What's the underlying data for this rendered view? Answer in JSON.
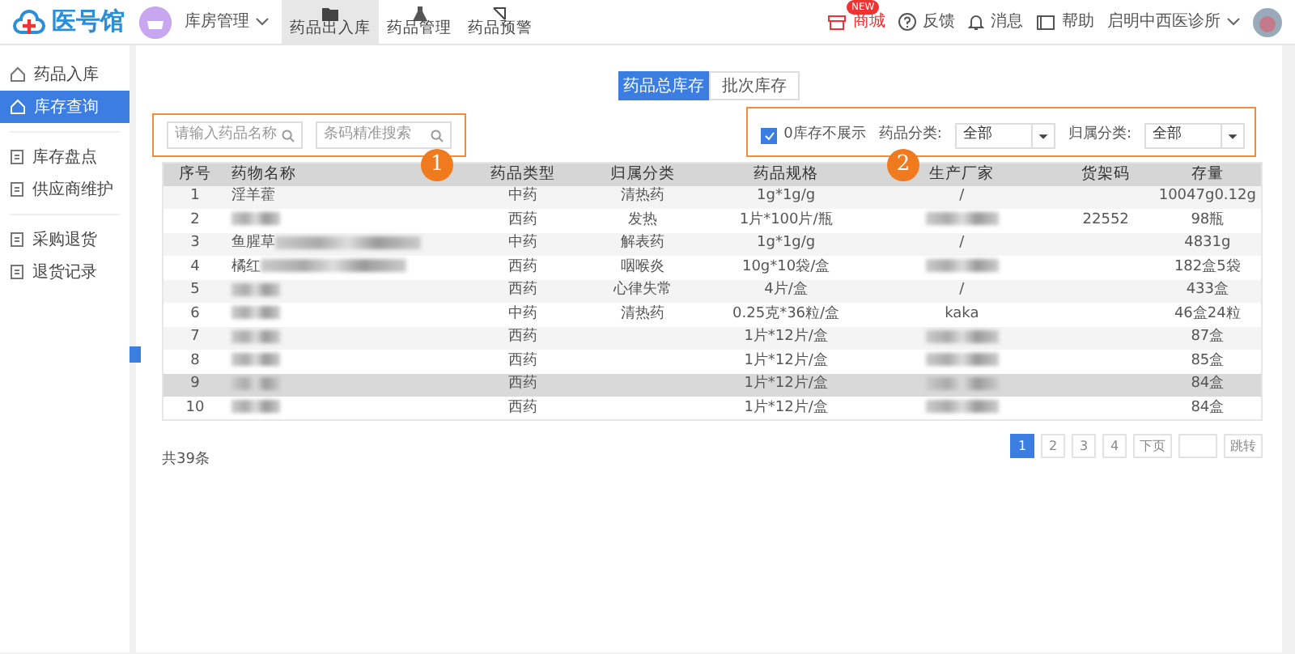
{
  "app": {
    "logo": "医号馆",
    "module": "库房管理",
    "tabs": [
      {
        "label": "药品出入库",
        "kind": "box",
        "selected": true
      },
      {
        "label": "药品管理",
        "kind": "flask",
        "selected": false
      },
      {
        "label": "药品预警",
        "kind": "alert",
        "selected": false
      }
    ],
    "header_links": [
      {
        "kind": "shop",
        "label": "商城",
        "badge": "NEW"
      },
      {
        "kind": "help",
        "label": "反馈"
      },
      {
        "kind": "bell",
        "label": "消息"
      },
      {
        "kind": "book",
        "label": "帮助"
      }
    ],
    "clinic": "启明中西医诊所"
  },
  "sidebar": {
    "groups": [
      [
        {
          "label": "药品入库",
          "kind": "home",
          "selected": false
        },
        {
          "label": "库存查询",
          "kind": "home",
          "selected": true
        }
      ],
      [
        {
          "label": "库存盘点",
          "kind": "doc",
          "selected": false
        },
        {
          "label": "供应商维护",
          "kind": "doc",
          "selected": false
        }
      ],
      [
        {
          "label": "采购退货",
          "kind": "doc",
          "selected": false
        },
        {
          "label": "退货记录",
          "kind": "doc",
          "selected": false
        }
      ]
    ]
  },
  "view_tabs": [
    {
      "label": "药品总库存",
      "selected": true
    },
    {
      "label": "批次库存",
      "selected": false
    }
  ],
  "search": [
    {
      "placeholder": "请输入药品名称"
    },
    {
      "placeholder": "条码精准搜索"
    }
  ],
  "filters": {
    "hide_zero": {
      "label": "0库存不展示",
      "checked": true
    },
    "selects": [
      {
        "label": "药品分类:",
        "value": "全部"
      },
      {
        "label": "归属分类:",
        "value": "全部"
      }
    ]
  },
  "callouts": [
    "1",
    "2"
  ],
  "table": {
    "columns": [
      "序号",
      "药物名称",
      "药品类型",
      "归属分类",
      "药品规格",
      "生产厂家",
      "货架码",
      "存量"
    ],
    "rows": [
      {
        "no": "1",
        "name": "淫羊藿",
        "type": "中药",
        "category": "清热药",
        "spec": "1g*1g/g",
        "maker": "/",
        "stock": "10047g0.12g",
        "selected": false
      },
      {
        "no": "2",
        "name_blurred": true,
        "type": "西药",
        "category": "发热",
        "spec": "1片*100片/瓶",
        "maker_blurred": true,
        "shelf": "22552",
        "stock": "98瓶",
        "selected": false
      },
      {
        "no": "3",
        "name": "鱼腥草",
        "name_blurred": true,
        "type": "中药",
        "category": "解表药",
        "spec": "1g*1g/g",
        "maker": "/",
        "stock": "4831g",
        "selected": false
      },
      {
        "no": "4",
        "name": "橘红",
        "name_blurred": true,
        "type": "西药",
        "category": "咽喉炎",
        "spec": "10g*10袋/盒",
        "maker_blurred": true,
        "stock": "182盒5袋",
        "selected": false
      },
      {
        "no": "5",
        "name_blurred": true,
        "type": "西药",
        "category": "心律失常",
        "spec": "4片/盒",
        "maker": "/",
        "stock": "433盒",
        "selected": false
      },
      {
        "no": "6",
        "name_blurred": true,
        "type": "中药",
        "category": "清热药",
        "spec": "0.25克*36粒/盒",
        "maker": "kaka",
        "stock": "46盒24粒",
        "selected": false
      },
      {
        "no": "7",
        "name_blurred": true,
        "type": "西药",
        "spec": "1片*12片/盒",
        "maker_blurred": true,
        "stock": "87盒",
        "selected": false
      },
      {
        "no": "8",
        "name_blurred": true,
        "type": "西药",
        "spec": "1片*12片/盒",
        "maker_blurred": true,
        "stock": "85盒",
        "selected": false
      },
      {
        "no": "9",
        "name_blurred": true,
        "type": "西药",
        "spec": "1片*12片/盒",
        "maker_blurred": true,
        "stock": "84盒",
        "selected": true
      },
      {
        "no": "10",
        "name_blurred": true,
        "type": "西药",
        "spec": "1片*12片/盒",
        "maker_blurred": true,
        "stock": "84盒",
        "selected": false
      }
    ]
  },
  "total": "共39条",
  "pagination": {
    "pages": [
      {
        "label": "1",
        "selected": true
      },
      {
        "label": "2",
        "selected": false
      },
      {
        "label": "3",
        "selected": false
      },
      {
        "label": "4",
        "selected": false
      }
    ],
    "next": "下页",
    "jump": "跳转"
  }
}
